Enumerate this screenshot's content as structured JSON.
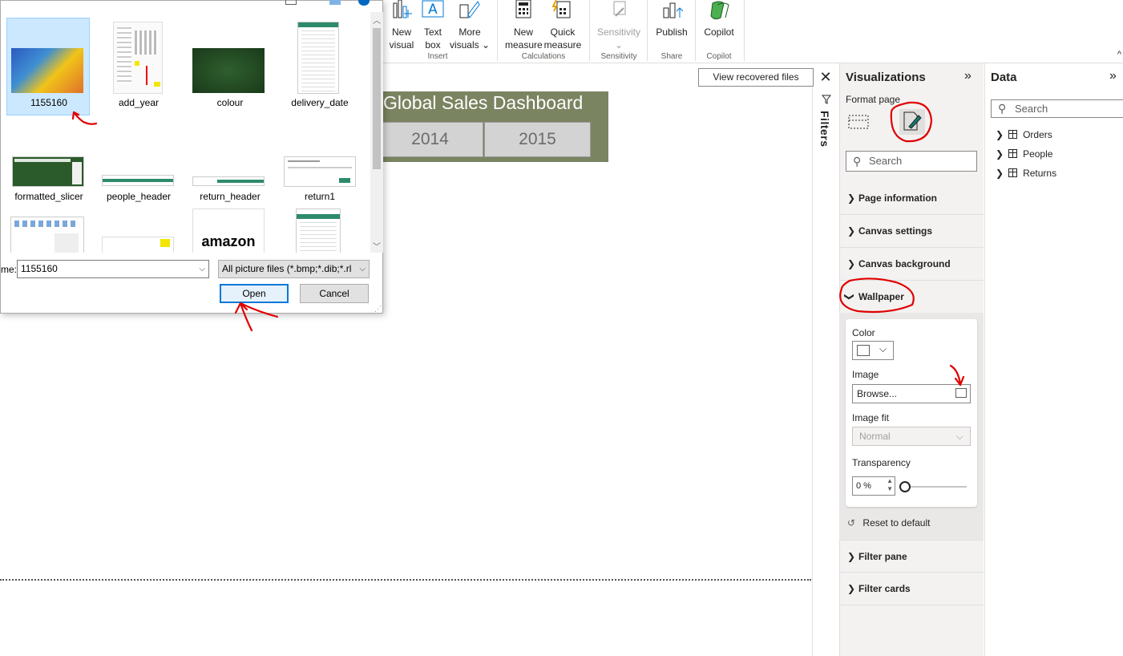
{
  "ribbon": {
    "buttons": [
      {
        "label1": "New",
        "label2": "visual"
      },
      {
        "label1": "Text",
        "label2": "box"
      },
      {
        "label1": "More",
        "label2": "visuals ⌄"
      },
      {
        "label1": "New",
        "label2": "measure"
      },
      {
        "label1": "Quick",
        "label2": "measure"
      },
      {
        "label1": "Sensitivity",
        "label2": "⌄"
      },
      {
        "label1": "Publish",
        "label2": ""
      },
      {
        "label1": "Copilot",
        "label2": ""
      }
    ],
    "groups": [
      "Insert",
      "Calculations",
      "Sensitivity",
      "Share",
      "Copilot"
    ],
    "collapse_caret": "^"
  },
  "canvas": {
    "recover_button": "View recovered files",
    "close_glyph": "✕",
    "dashboard_title": "Global Sales Dashboard",
    "slicer_years": [
      "2014",
      "2015"
    ]
  },
  "filters": {
    "label": "Filters"
  },
  "visualizations": {
    "title": "Visualizations",
    "expand_glyph": "»",
    "format_page_label": "Format page",
    "search_placeholder": "Search",
    "sections": {
      "page_information": "Page information",
      "canvas_settings": "Canvas settings",
      "canvas_background": "Canvas background",
      "wallpaper": "Wallpaper",
      "filter_pane": "Filter pane",
      "filter_cards": "Filter cards"
    },
    "wallpaper": {
      "color_label": "Color",
      "color_value": "#ffffff",
      "image_label": "Image",
      "browse_text": "Browse...",
      "image_fit_label": "Image fit",
      "image_fit_value": "Normal",
      "transparency_label": "Transparency",
      "transparency_value": "0 %",
      "transparency_level": 0,
      "reset_label": "Reset to default"
    }
  },
  "data_pane": {
    "title": "Data",
    "expand_glyph": "»",
    "search_placeholder": "Search",
    "tables": [
      "Orders",
      "People",
      "Returns"
    ]
  },
  "file_dialog": {
    "files": [
      {
        "name": "1155160",
        "selected": true
      },
      {
        "name": "add_year",
        "selected": false
      },
      {
        "name": "colour",
        "selected": false
      },
      {
        "name": "delivery_date",
        "selected": false
      },
      {
        "name": "formatted_slicer",
        "selected": false
      },
      {
        "name": "people_header",
        "selected": false
      },
      {
        "name": "return_header",
        "selected": false
      },
      {
        "name": "return1",
        "selected": false
      }
    ],
    "thumbnail_text": "amazon",
    "filename_label": "me:",
    "filename_value": "1155160",
    "filetype_value": "All picture files (*.bmp;*.dib;*.rl",
    "open_button": "Open",
    "cancel_button": "Cancel"
  },
  "colors": {
    "banner": "#7b8461",
    "annotation_red": "#e00000",
    "selection_blue": "#cce8ff",
    "primary_border": "#0078d7"
  }
}
